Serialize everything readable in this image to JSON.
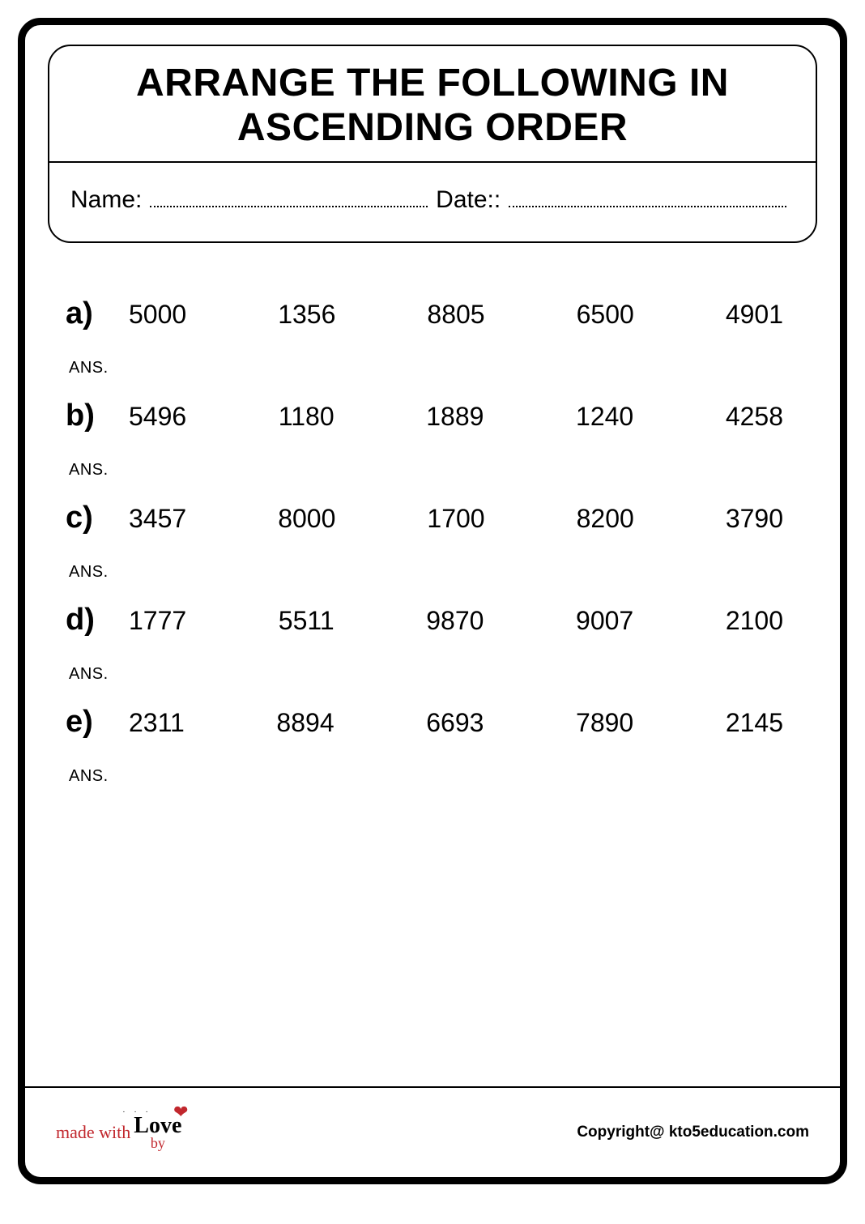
{
  "title_line1": "ARRANGE THE FOLLOWING IN",
  "title_line2": "ASCENDING ORDER",
  "name_label": "Name:",
  "date_label": "Date::",
  "ans_label": "ANS.",
  "questions": [
    {
      "label": "a)",
      "numbers": [
        "5000",
        "1356",
        "8805",
        "6500",
        "4901"
      ]
    },
    {
      "label": "b)",
      "numbers": [
        "5496",
        "1180",
        "1889",
        "1240",
        "4258"
      ]
    },
    {
      "label": "c)",
      "numbers": [
        "3457",
        "8000",
        "1700",
        "8200",
        "3790"
      ]
    },
    {
      "label": "d)",
      "numbers": [
        "1777",
        "5511",
        "9870",
        "9007",
        "2100"
      ]
    },
    {
      "label": "e)",
      "numbers": [
        "2311",
        "8894",
        "6693",
        "7890",
        "2145"
      ]
    }
  ],
  "footer": {
    "made_with": "made with",
    "love": "Love",
    "by": "by",
    "copyright": "Copyright@ kto5education.com"
  }
}
